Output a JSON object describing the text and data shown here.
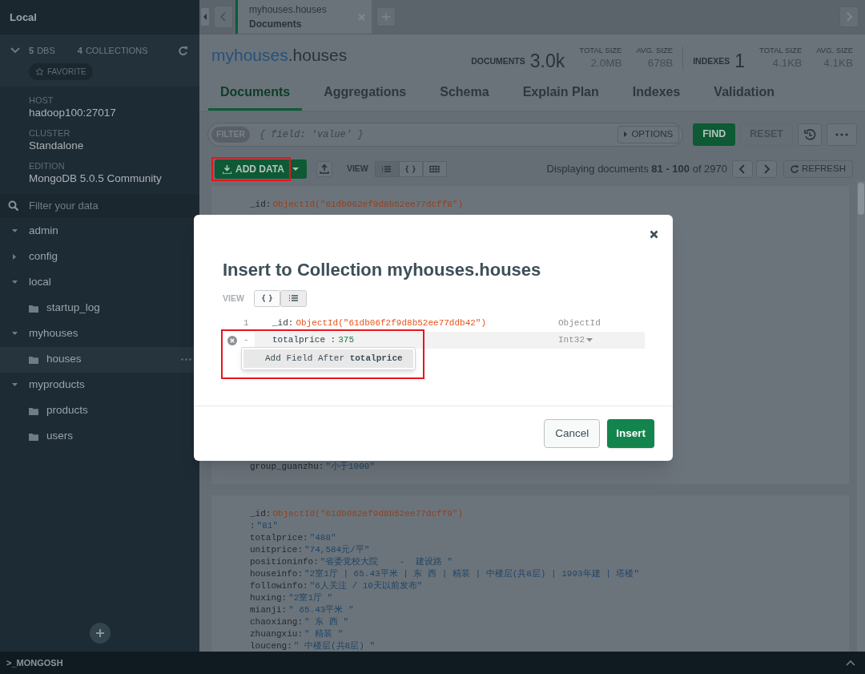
{
  "sidebar": {
    "title": "Local",
    "dbs_count": "5",
    "dbs_label": "DBS",
    "collections_count": "4",
    "collections_label": "COLLECTIONS",
    "favorite": "FAVORITE",
    "info": [
      {
        "label": "HOST",
        "value": "hadoop100:27017"
      },
      {
        "label": "CLUSTER",
        "value": "Standalone"
      },
      {
        "label": "EDITION",
        "value": "MongoDB 5.0.5 Community"
      }
    ],
    "filter": {
      "placeholder": "Filter your data"
    },
    "databases": [
      {
        "name": "admin",
        "expanded": true
      },
      {
        "name": "config",
        "expanded": false
      },
      {
        "name": "local",
        "expanded": true,
        "children": [
          {
            "name": "startup_log",
            "selected": false
          }
        ]
      },
      {
        "name": "myhouses",
        "expanded": true,
        "children": [
          {
            "name": "houses",
            "selected": true
          }
        ]
      },
      {
        "name": "myproducts",
        "expanded": true,
        "children": [
          {
            "name": "products",
            "selected": false
          },
          {
            "name": "users",
            "selected": false
          }
        ]
      }
    ]
  },
  "tab": {
    "namespace": "myhouses.houses",
    "subtitle": "Documents"
  },
  "header": {
    "db": "myhouses",
    "collection": ".houses",
    "stats": [
      {
        "label": "DOCUMENTS",
        "value": "3.0k",
        "kind": "big"
      },
      {
        "label": "TOTAL SIZE",
        "value": "2.0MB",
        "kind": "small"
      },
      {
        "label": "AVG. SIZE",
        "value": "678B",
        "kind": "small"
      },
      {
        "label": "INDEXES",
        "value": "1",
        "kind": "big"
      },
      {
        "label": "TOTAL SIZE",
        "value": "4.1KB",
        "kind": "small"
      },
      {
        "label": "AVG. SIZE",
        "value": "4.1KB",
        "kind": "small"
      }
    ]
  },
  "tabs": [
    {
      "label": "Documents",
      "selected": true
    },
    {
      "label": "Aggregations",
      "selected": false
    },
    {
      "label": "Schema",
      "selected": false
    },
    {
      "label": "Explain Plan",
      "selected": false
    },
    {
      "label": "Indexes",
      "selected": false
    },
    {
      "label": "Validation",
      "selected": false
    }
  ],
  "query": {
    "badge": "FILTER",
    "placeholder": "{ field: 'value' }",
    "options": "OPTIONS",
    "find": "FIND",
    "reset": "RESET"
  },
  "toolbar": {
    "add_data": "ADD DATA",
    "view_label": "VIEW",
    "views": [
      {
        "kind": "list",
        "selected": true
      },
      {
        "kind": "json",
        "selected": false
      },
      {
        "kind": "table",
        "selected": false
      }
    ],
    "paging": "Displaying documents **81 - 100** of 2970",
    "refresh": "REFRESH"
  },
  "documents": [
    {
      "fields": [
        {
          "key": "_id:",
          "value": "ObjectId(\"61db062ef9d8b52ee77dcff8\")",
          "kind": "objectid"
        }
      ],
      "tail": [
        {
          "key": "group_guanzhu:",
          "value": "\"小于1000\"",
          "kind": "string"
        }
      ]
    },
    {
      "fields": [
        {
          "key": "_id:",
          "value": "ObjectId(\"61db062ef9d8b52ee77dcff9\")",
          "kind": "objectid"
        },
        {
          "key": ":",
          "value": "\"81\"",
          "kind": "string"
        },
        {
          "key": "totalprice:",
          "value": "\"488\"",
          "kind": "string"
        },
        {
          "key": "unitprice:",
          "value": "\"74,584元/平\"",
          "kind": "string"
        },
        {
          "key": "positioninfo:",
          "value": "\"省委党校大院    -  建设路 \"",
          "kind": "string"
        },
        {
          "key": "houseinfo:",
          "value": "\"2室1厅 | 65.43平米 | 东 西 | 精装 | 中楼层(共8层) | 1993年建 | 塔楼\"",
          "kind": "string"
        },
        {
          "key": "followinfo:",
          "value": "\"6人关注 / 10天以前发布\"",
          "kind": "string"
        },
        {
          "key": "huxing:",
          "value": "\"2室1厅 \"",
          "kind": "string"
        },
        {
          "key": "mianji:",
          "value": "\" 65.43平米 \"",
          "kind": "string"
        },
        {
          "key": "chaoxiang:",
          "value": "\" 东 西 \"",
          "kind": "string"
        },
        {
          "key": "zhuangxiu:",
          "value": "\" 精装 \"",
          "kind": "string"
        },
        {
          "key": "louceng:",
          "value": "\" 中楼层(共8层) \"",
          "kind": "string"
        }
      ]
    }
  ],
  "modal": {
    "title": "Insert to Collection myhouses.houses",
    "view_label": "VIEW",
    "views": [
      {
        "kind": "json",
        "selected": false
      },
      {
        "kind": "list",
        "selected": true
      }
    ],
    "rows": [
      {
        "line": "1",
        "key": "_id:",
        "value": "ObjectId(\"61db06f2f9d8b52ee77ddb42\")",
        "kind": "objectid",
        "type": "ObjectId",
        "highlighted": false
      },
      {
        "line": "-",
        "key": "totalprice :",
        "value": "375",
        "kind": "number",
        "type": "Int32",
        "highlighted": true
      }
    ],
    "menu_item": "Add Field After **totalprice**",
    "cancel": "Cancel",
    "insert": "Insert"
  },
  "shell": ">_MONGOSH"
}
